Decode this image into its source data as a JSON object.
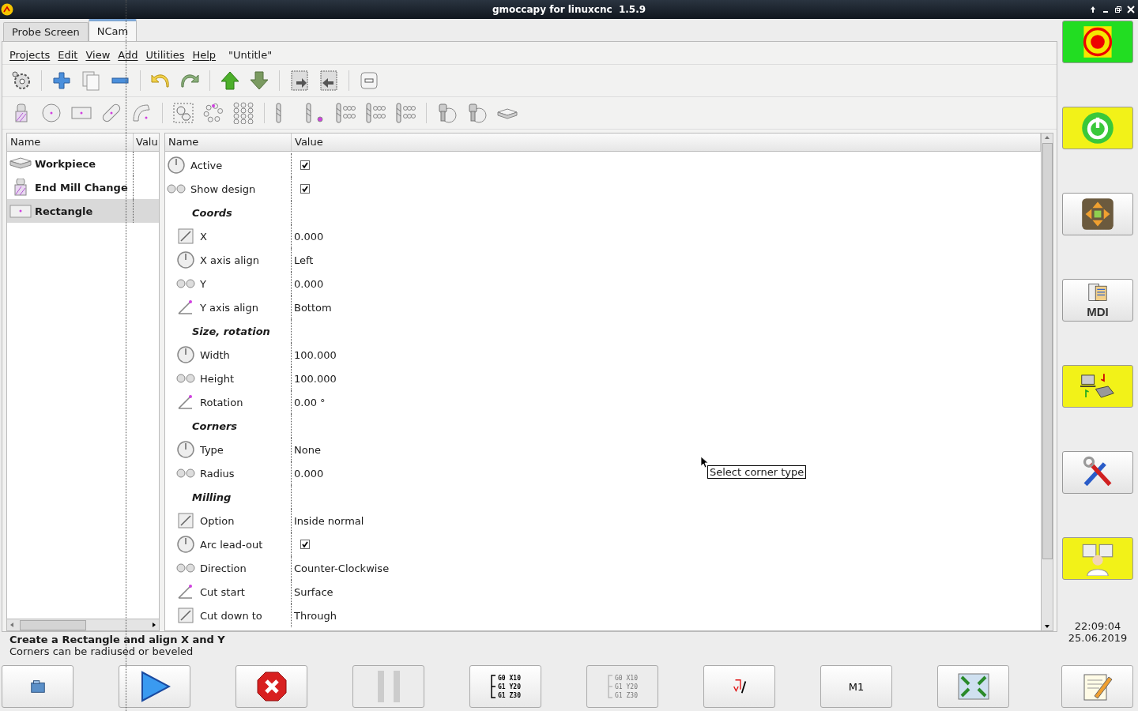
{
  "window": {
    "title": "gmoccapy for linuxcnc  1.5.9"
  },
  "tabs": [
    {
      "label": "Probe Screen",
      "selected": false
    },
    {
      "label": "NCam",
      "selected": true
    }
  ],
  "menu": [
    "Projects",
    "Edit",
    "View",
    "Add",
    "Utilities",
    "Help"
  ],
  "project_title": "\"Untitle\"",
  "tree": {
    "columns": [
      "Name",
      "Valu"
    ],
    "items": [
      {
        "label": "Workpiece",
        "selected": false
      },
      {
        "label": "End Mill Change",
        "selected": false
      },
      {
        "label": "Rectangle",
        "selected": true
      }
    ]
  },
  "properties": {
    "columns": [
      "Name",
      "Value"
    ],
    "rows": [
      {
        "kind": "check",
        "name": "Active",
        "checked": true
      },
      {
        "kind": "check",
        "name": "Show design",
        "checked": true
      },
      {
        "kind": "group",
        "name": "Coords"
      },
      {
        "kind": "text",
        "name": "X",
        "value": "0.000"
      },
      {
        "kind": "text",
        "name": "X axis align",
        "value": "Left"
      },
      {
        "kind": "text",
        "name": "Y",
        "value": "0.000"
      },
      {
        "kind": "text",
        "name": "Y axis align",
        "value": "Bottom"
      },
      {
        "kind": "group",
        "name": "Size, rotation"
      },
      {
        "kind": "text",
        "name": "Width",
        "value": "100.000"
      },
      {
        "kind": "text",
        "name": "Height",
        "value": "100.000"
      },
      {
        "kind": "text",
        "name": "Rotation",
        "value": "0.00 °"
      },
      {
        "kind": "group",
        "name": "Corners"
      },
      {
        "kind": "text",
        "name": "Type",
        "value": "None"
      },
      {
        "kind": "text",
        "name": "Radius",
        "value": "0.000"
      },
      {
        "kind": "group",
        "name": "Milling"
      },
      {
        "kind": "text",
        "name": "Option",
        "value": "Inside normal"
      },
      {
        "kind": "check",
        "name": "Arc lead-out",
        "checked": true
      },
      {
        "kind": "text",
        "name": "Direction",
        "value": "Counter-Clockwise"
      },
      {
        "kind": "text",
        "name": "Cut start",
        "value": "Surface"
      },
      {
        "kind": "text",
        "name": "Cut down to",
        "value": "Through"
      }
    ]
  },
  "tooltip": "Select corner type",
  "status": {
    "title": "Create a Rectangle and align X and Y",
    "detail": "Corners can be radiused or beveled"
  },
  "side_buttons": [
    {
      "kind": "estop",
      "on": true
    },
    {
      "kind": "power",
      "on": true
    },
    {
      "kind": "jog",
      "on": false
    },
    {
      "kind": "mdi",
      "label": "MDI",
      "on": false
    },
    {
      "kind": "auto",
      "on": true
    },
    {
      "kind": "settings",
      "on": false
    },
    {
      "kind": "user",
      "on": true
    }
  ],
  "clock": {
    "time": "22:09:04",
    "date": "25.06.2019"
  },
  "bottom_buttons": [
    {
      "kind": "open",
      "disabled": false
    },
    {
      "kind": "run",
      "disabled": false
    },
    {
      "kind": "stop",
      "disabled": false
    },
    {
      "kind": "pause",
      "disabled": true
    },
    {
      "kind": "step",
      "disabled": false,
      "lines": [
        "G0 X10",
        "G1 Y20",
        "G1 Z30"
      ]
    },
    {
      "kind": "step",
      "disabled": true,
      "lines": [
        "G0 X10",
        "G1 Y20",
        "G1 Z30"
      ]
    },
    {
      "kind": "skip",
      "disabled": false
    },
    {
      "kind": "label",
      "disabled": false,
      "label": "M1"
    },
    {
      "kind": "fullscreen",
      "disabled": false
    },
    {
      "kind": "edit",
      "disabled": false
    }
  ]
}
